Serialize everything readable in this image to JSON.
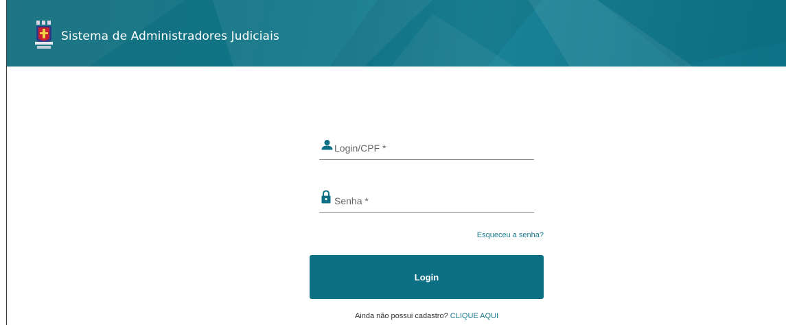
{
  "header": {
    "title": "Sistema de Administradores Judiciais",
    "colors": {
      "bar": "#0f7486"
    }
  },
  "form": {
    "login_placeholder": "Login/CPF *",
    "login_icon": "user-icon",
    "password_placeholder": "Senha *",
    "password_icon": "lock-icon",
    "forgot_label": "Esqueceu a senha?",
    "submit_label": "Login",
    "register_text": "Ainda não possui cadastro?",
    "register_link": "CLIQUE AQUI"
  },
  "colors": {
    "accent": "#0d6f83",
    "link": "#1b7b8f"
  }
}
